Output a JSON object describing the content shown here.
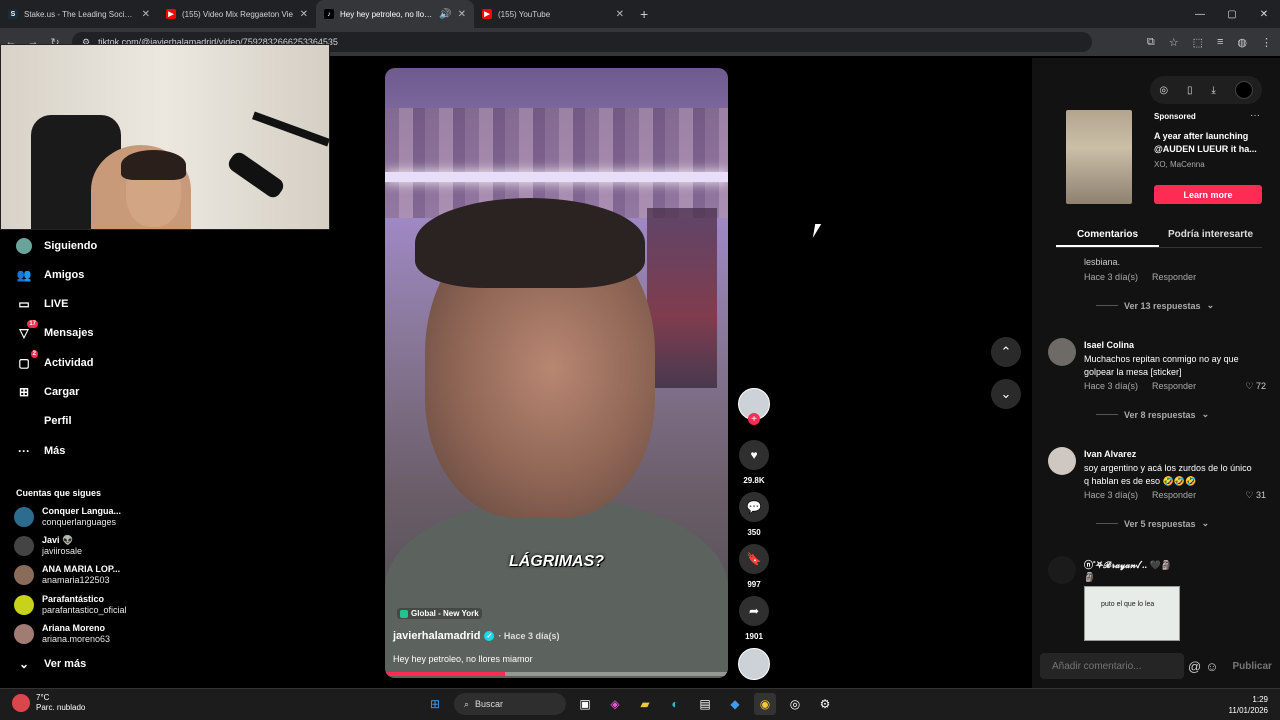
{
  "browser": {
    "tabs": [
      {
        "title": "Stake.us - The Leading Social C",
        "favicon": "S",
        "color": "#1a2c38",
        "active": false
      },
      {
        "title": "(155) Video Mix Reggaeton Vie",
        "favicon": "▶",
        "color": "#ff0000",
        "active": false
      },
      {
        "title": "Hey hey petroleo, no llores",
        "favicon": "♪",
        "color": "#000000",
        "active": true
      },
      {
        "title": "(155) YouTube",
        "favicon": "▶",
        "color": "#ff0000",
        "active": false
      }
    ],
    "url": "tiktok.com/@javierhalamadrid/video/7592832666253364535",
    "new_tab": "+",
    "window_controls": [
      "—",
      "▢",
      "✕"
    ]
  },
  "sidebar": {
    "items": [
      {
        "label": "Siguiendo",
        "icon": "avatar-icon",
        "badge": ""
      },
      {
        "label": "Amigos",
        "icon": "friends-icon",
        "badge": ""
      },
      {
        "label": "LIVE",
        "icon": "live-icon",
        "badge": ""
      },
      {
        "label": "Mensajes",
        "icon": "paper-plane-icon",
        "badge": "17"
      },
      {
        "label": "Actividad",
        "icon": "inbox-icon",
        "badge": "2"
      },
      {
        "label": "Cargar",
        "icon": "plus-square-icon",
        "badge": ""
      },
      {
        "label": "Perfil",
        "icon": "",
        "badge": ""
      },
      {
        "label": "Más",
        "icon": "dots-icon",
        "badge": ""
      }
    ],
    "follows_heading": "Cuentas que sigues",
    "follows": [
      {
        "name": "Conquer Langua...",
        "handle": "conquerlanguages",
        "color": "#2d6b8f"
      },
      {
        "name": "Javi 👽",
        "handle": "javiirosale",
        "color": "#444444"
      },
      {
        "name": "ANA MARIA LOP...",
        "handle": "anamaria122503",
        "color": "#8a6a58"
      },
      {
        "name": "Parafantástico",
        "handle": "parafantastico_oficial",
        "color": "#c8d21a"
      },
      {
        "name": "Ariana Moreno",
        "handle": "ariana.moreno63",
        "color": "#a07c72"
      }
    ],
    "see_more": "Ver más"
  },
  "video": {
    "caption": "LÁGRIMAS?",
    "location": "Global - New York",
    "author": "javierhalamadrid",
    "time": "· Hace 3 día(s)",
    "description": "Hey hey petroleo, no llores miamor",
    "progress": 0.35
  },
  "actions": {
    "likes": "29.8K",
    "comments": "350",
    "saves": "997",
    "shares": "1901"
  },
  "ad": {
    "sponsored": "Sponsored",
    "text": "A year after launching @AUDEN LUEUR it ha...",
    "sub": "XO, MaCenna",
    "cta": "Learn more"
  },
  "panel_tabs": [
    "Comentarios",
    "Podría interesarte"
  ],
  "comments": {
    "top": {
      "text": "lesbiana.",
      "date": "Hace 3 día(s)",
      "reply": "Responder",
      "more": "Ver 13 respuestas"
    },
    "list": [
      {
        "name": "Isael Colina",
        "text": "Muchachos repitan conmigo no ay que golpear la mesa [sticker]",
        "date": "Hace 3 día(s)",
        "reply": "Responder",
        "likes": "72",
        "more": "Ver 8 respuestas"
      },
      {
        "name": "Ivan Alvarez",
        "text": "soy argentino y acá los zurdos de lo único q hablan es de eso 🤣🤣🤣",
        "date": "Hace 3 día(s)",
        "reply": "Responder",
        "likes": "31",
        "more": "Ver 5 respuestas"
      },
      {
        "name": "ⓝ˚⛧ℬ𝓇𝒶𝓎𝒶𝓃✓.. 🖤🗿",
        "text": "🗿"
      }
    ],
    "sticker_text": "puto el que lo lea",
    "input_placeholder": "Añadir comentario...",
    "publish": "Publicar"
  },
  "taskbar": {
    "temp": "7°C",
    "weather": "Parc. nublado",
    "search": "Buscar",
    "time": "1:29",
    "date": "11/01/2026"
  }
}
